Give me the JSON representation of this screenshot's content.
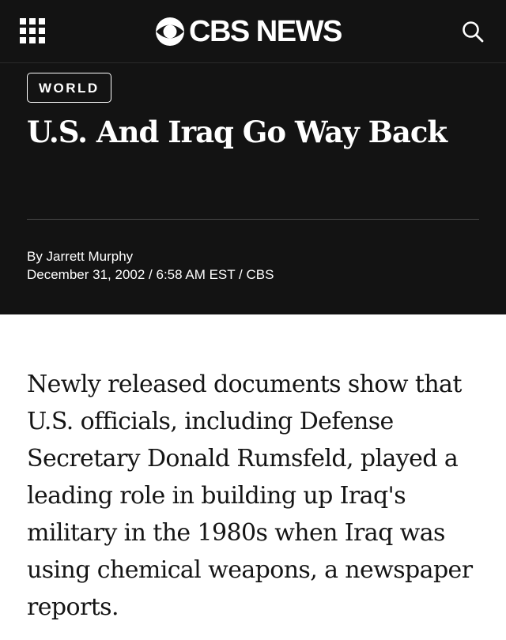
{
  "topbar": {
    "menu_icon": "grid-menu-icon",
    "brand": "CBS NEWS",
    "brand_icon": "cbs-eye-logo-icon",
    "search_icon": "search-icon"
  },
  "article": {
    "section": "WORLD",
    "headline": "U.S. And Iraq Go Way Back",
    "byline": "By Jarrett Murphy",
    "dateline": "December 31, 2002 / 6:58 AM EST / CBS",
    "body": "Newly released documents show that U.S. officials, including Defense Secretary Donald Rumsfeld, played a leading role in building up Iraq's military in the 1980s when Iraq was using chemical weapons, a newspaper reports."
  },
  "colors": {
    "header_bg": "#131313",
    "text_on_dark": "#ffffff",
    "body_text": "#151515"
  }
}
